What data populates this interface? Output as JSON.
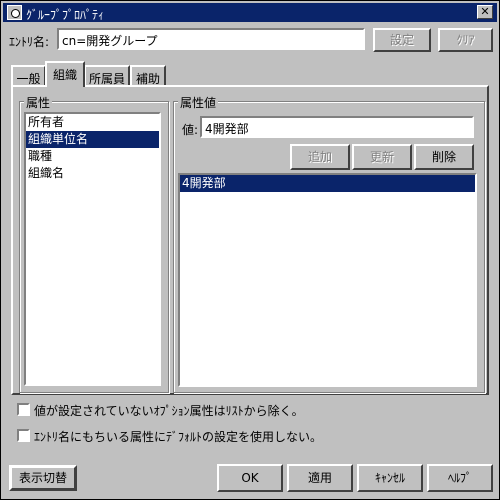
{
  "window": {
    "title": "ｸﾞﾙｰﾌﾟﾌﾟﾛﾊﾟﾃｨ"
  },
  "entry": {
    "label": "ｴﾝﾄﾘ名:",
    "value": "cn=開発グループ",
    "set_button": "設定",
    "clear_button": "ｸﾘｱ"
  },
  "tabs": [
    {
      "label": "一般"
    },
    {
      "label": "組織"
    },
    {
      "label": "所属員"
    },
    {
      "label": "補助"
    }
  ],
  "attributes": {
    "title": "属性",
    "items": [
      "所有者",
      "組織単位名",
      "職種",
      "組織名"
    ],
    "selected_index": 1
  },
  "attribute_values": {
    "title": "属性値",
    "value_label": "値:",
    "value": "4開発部",
    "add_button": "追加",
    "update_button": "更新",
    "delete_button": "削除",
    "items": [
      "4開発部"
    ]
  },
  "options": {
    "exclude_unset_optional": "値が設定されていないｵﾌﾟｼｮﾝ属性はﾘｽﾄから除く。",
    "no_default_for_entry_attr": "ｴﾝﾄﾘ名にもちいる属性にﾃﾞﾌｫﾙﾄの設定を使用しない。"
  },
  "footer": {
    "toggle_display": "表示切替",
    "ok": "OK",
    "apply": "適用",
    "cancel": "ｷｬﾝｾﾙ",
    "help": "ﾍﾙﾌﾟ"
  }
}
